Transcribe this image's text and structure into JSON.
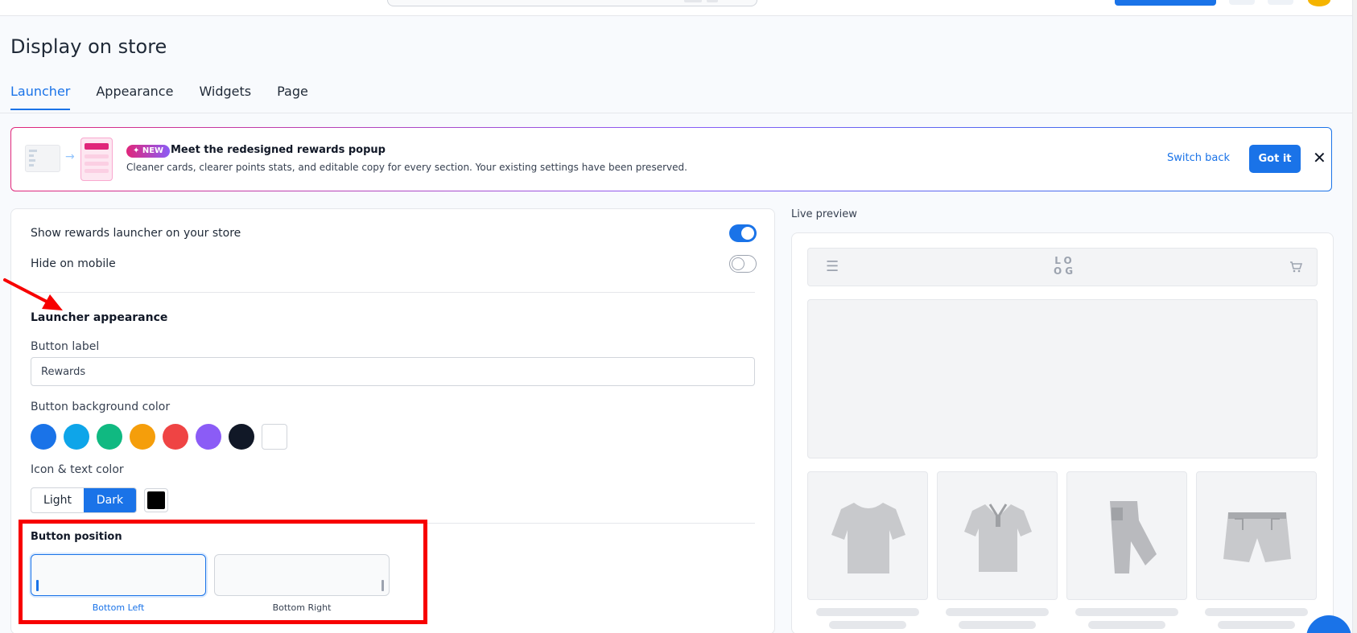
{
  "page": {
    "title": "Display on store"
  },
  "tabs": [
    {
      "label": "Launcher"
    },
    {
      "label": "Appearance"
    },
    {
      "label": "Widgets"
    },
    {
      "label": "Page"
    }
  ],
  "banner": {
    "badge": "✦ NEW",
    "title": "Meet the redesigned rewards popup",
    "text": "Cleaner cards, clearer points stats, and editable copy for every section. Your existing settings have been preserved.",
    "switch_back": "Switch back",
    "got_it": "Got it",
    "close": "✕"
  },
  "settings": {
    "show_launcher_label": "Show rewards launcher on your store",
    "show_launcher_on": true,
    "hide_mobile_label": "Hide on mobile",
    "hide_mobile_on": false,
    "section_title": "Launcher appearance",
    "button_label_title": "Button label",
    "button_label_value": "Rewards",
    "bg_color_title": "Button background color",
    "bg_colors": [
      "#1a73e8",
      "#0ea5e9",
      "#10b981",
      "#f59e0b",
      "#ef4444",
      "#8b5cf6",
      "#111827",
      "#ffffff"
    ],
    "icon_color_title": "Icon & text color",
    "icon_color_options": [
      "Light",
      "Dark"
    ],
    "icon_color_selected": "Dark",
    "position_title": "Button position",
    "position_left": "Bottom Left",
    "position_right": "Bottom Right",
    "position_selected": "Bottom Left"
  },
  "preview": {
    "label": "Live preview",
    "logo_line1": "LO",
    "logo_line2": "OG"
  },
  "colors": {
    "accent": "#1a73e8",
    "annotation": "#f70000"
  }
}
